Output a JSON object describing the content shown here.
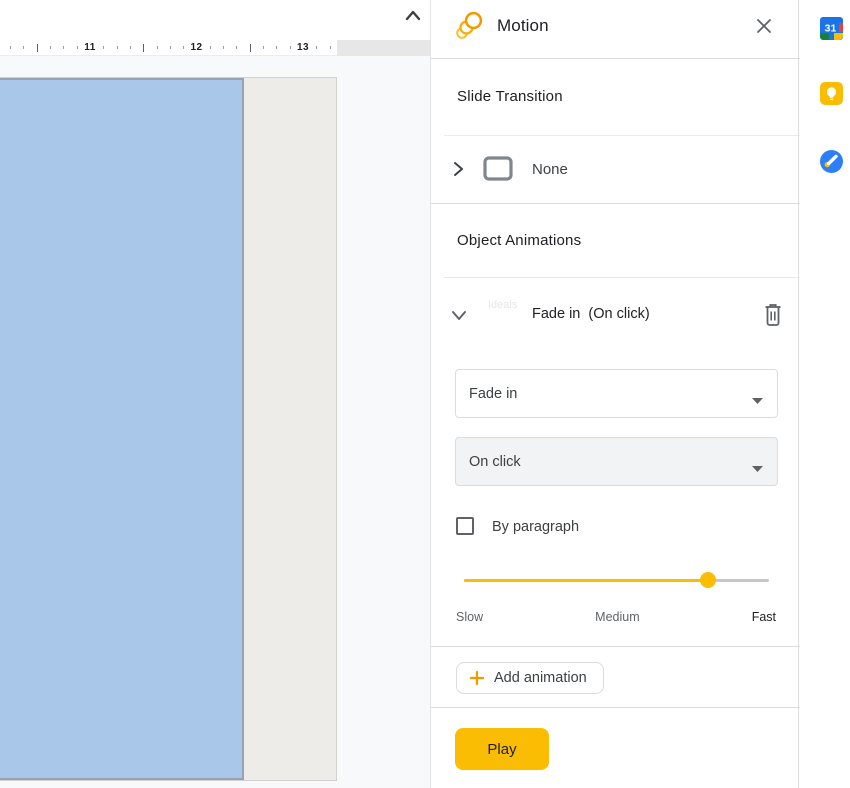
{
  "canvas": {
    "ruler_numbers": [
      "11",
      "12",
      "13"
    ]
  },
  "panel": {
    "title": "Motion",
    "slide_transition": {
      "heading": "Slide Transition",
      "value": "None"
    },
    "object_animations": {
      "heading": "Object Animations",
      "animation_summary": "Fade in  (On click)",
      "ghost_text": "Ideals",
      "effect_value": "Fade in",
      "trigger_value": "On click",
      "by_paragraph": {
        "label": "By paragraph",
        "checked": false
      },
      "speed": {
        "labels": [
          "Slow",
          "Medium",
          "Fast"
        ],
        "value_percent": 80
      },
      "add_animation_label": "Add animation"
    },
    "play_label": "Play"
  },
  "apps_bar": {
    "calendar_day": "31"
  },
  "colors": {
    "accent_yellow": "#fbbc04",
    "plus_orange": "#f29900",
    "slide_fill_blue": "#a9c7e8",
    "panel_divider": "#dadce0"
  }
}
